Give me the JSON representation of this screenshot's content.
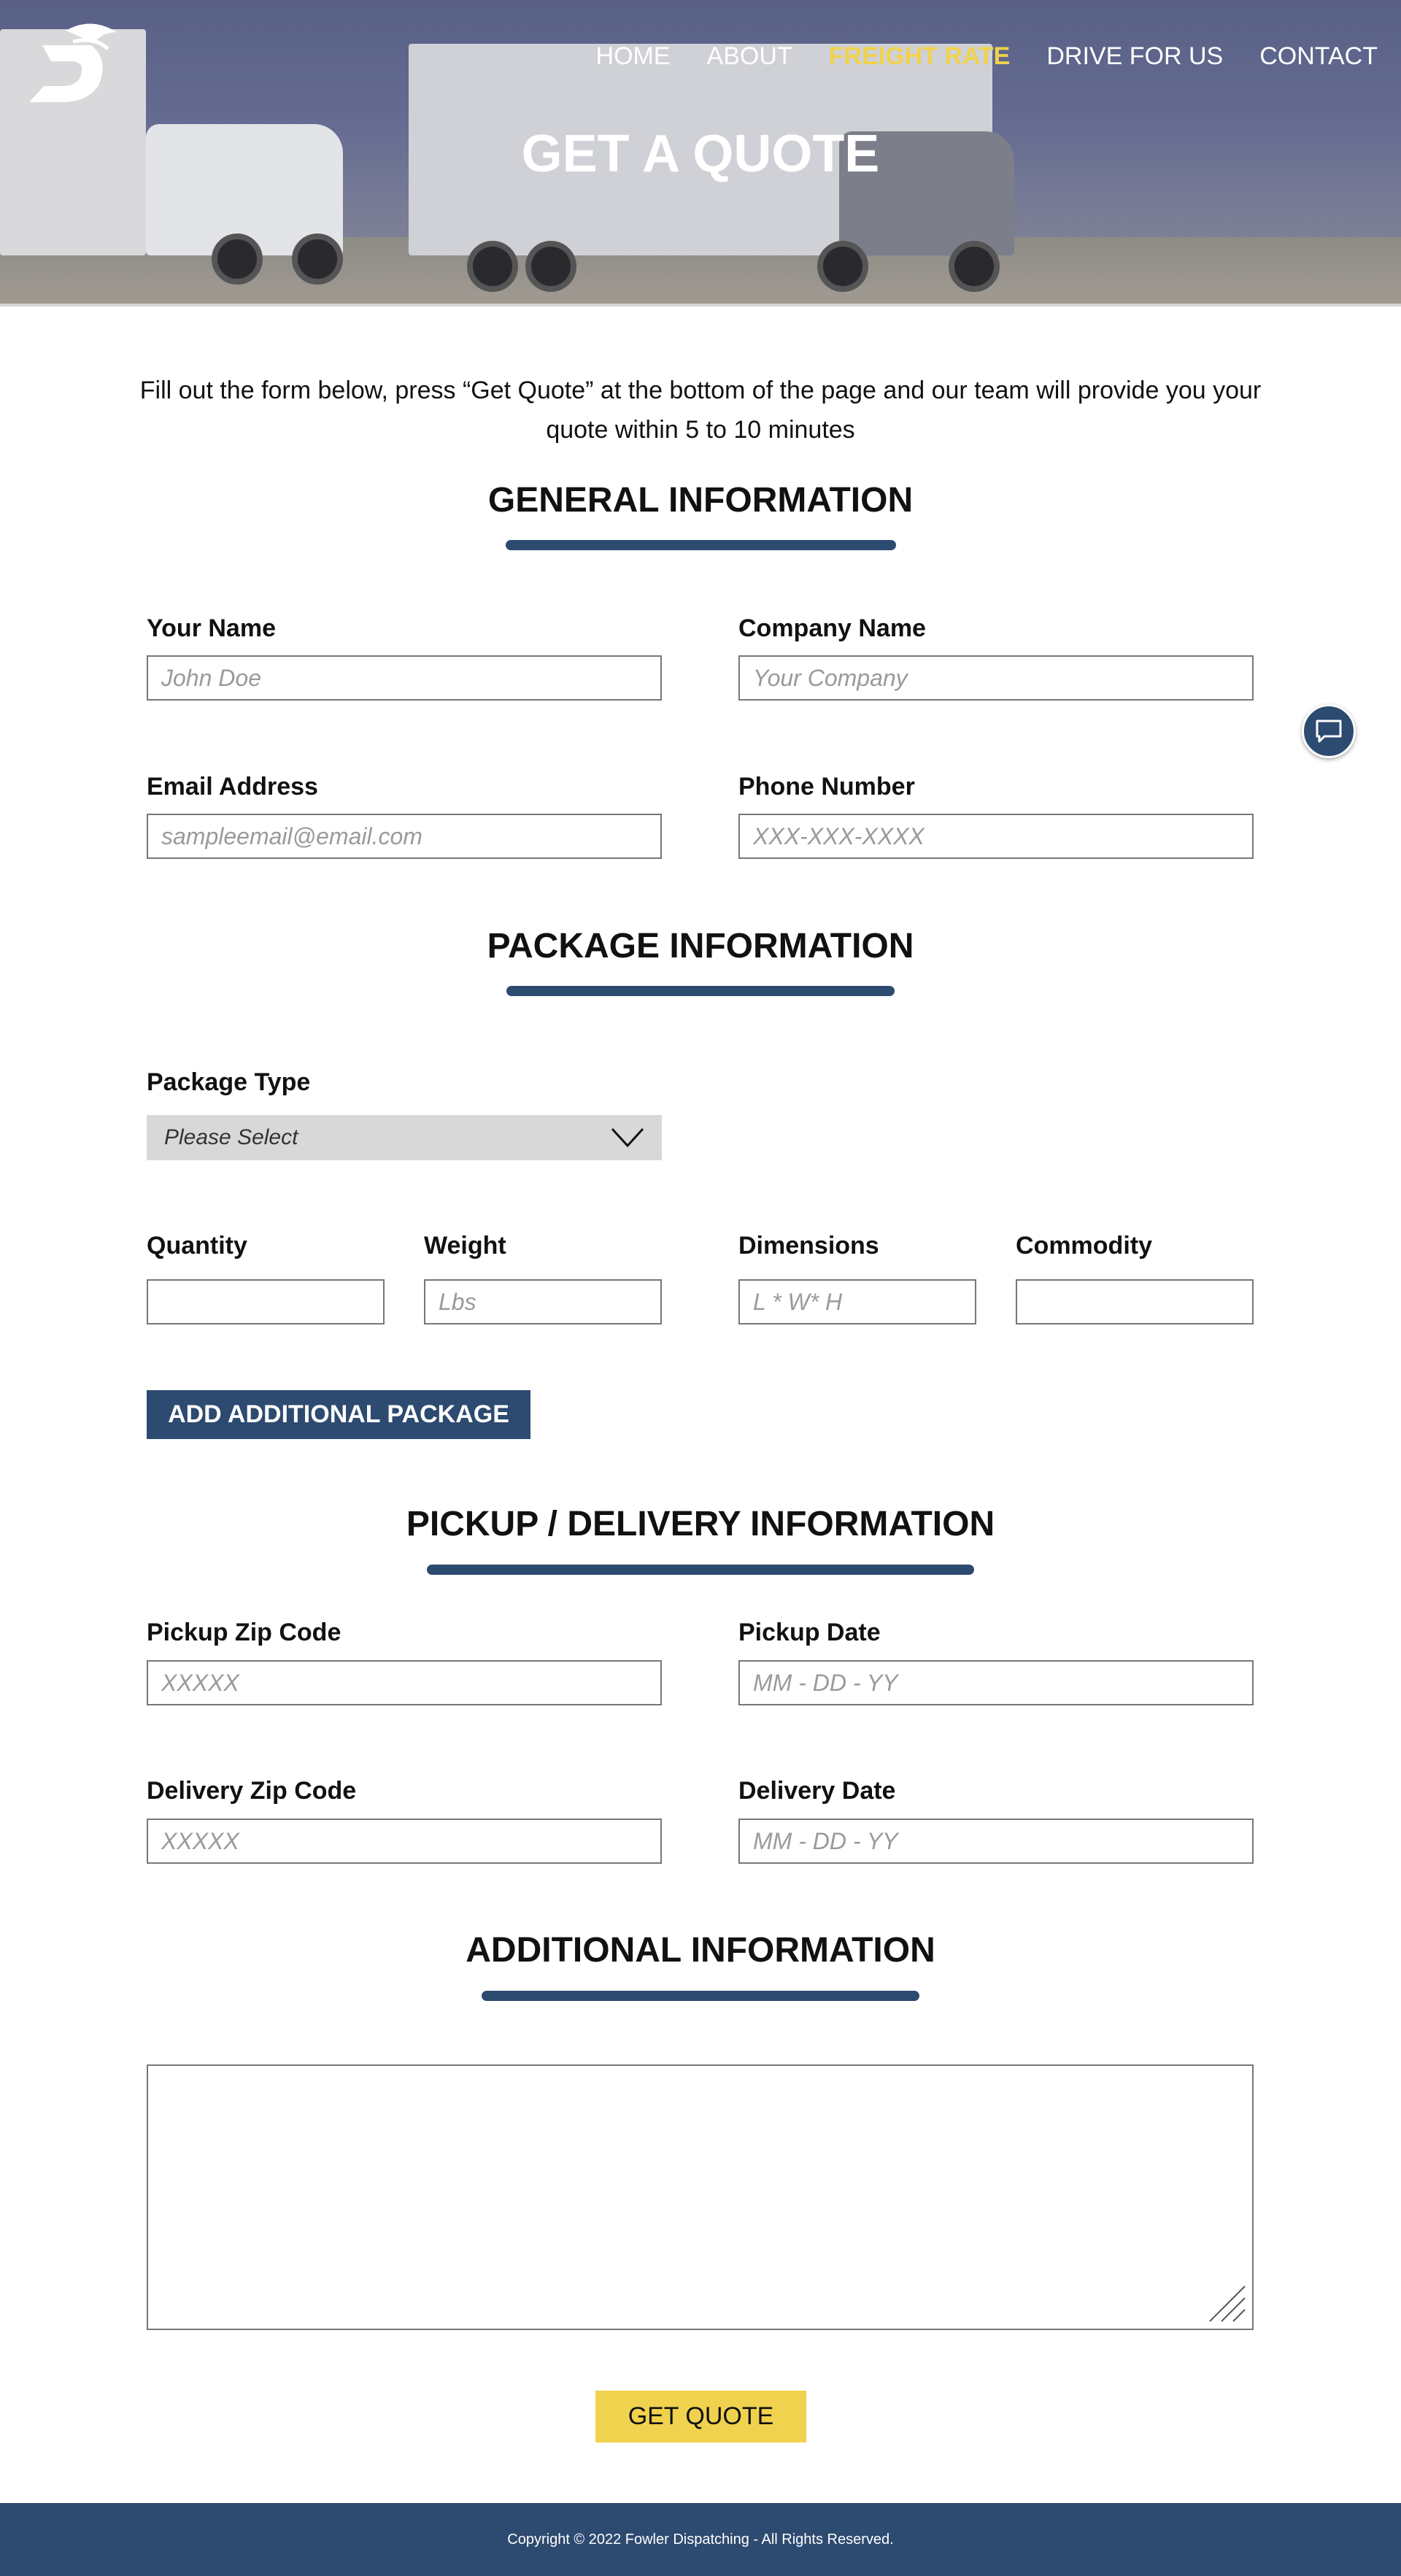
{
  "nav": {
    "items": [
      {
        "label": "HOME"
      },
      {
        "label": "ABOUT"
      },
      {
        "label": "FREIGHT RATE",
        "active": true
      },
      {
        "label": "DRIVE FOR US"
      },
      {
        "label": "CONTACT"
      }
    ]
  },
  "hero": {
    "title": "GET A QUOTE"
  },
  "intro": "Fill out the form below, press “Get Quote” at the bottom of the page and our team will provide you your quote within 5 to 10 minutes",
  "general": {
    "title": "GENERAL INFORMATION",
    "name_label": "Your Name",
    "name_placeholder": "John Doe",
    "company_label": "Company Name",
    "company_placeholder": "Your Company",
    "email_label": "Email Address",
    "email_placeholder": "sampleemail@email.com",
    "phone_label": "Phone Number",
    "phone_placeholder": "XXX-XXX-XXXX"
  },
  "package": {
    "title": "PACKAGE INFORMATION",
    "type_label": "Package Type",
    "type_value": "Please Select",
    "quantity_label": "Quantity",
    "quantity_placeholder": "",
    "weight_label": "Weight",
    "weight_placeholder": "Lbs",
    "dimensions_label": "Dimensions",
    "dimensions_placeholder": "L * W* H",
    "commodity_label": "Commodity",
    "commodity_placeholder": "",
    "add_button": "ADD ADDITIONAL PACKAGE"
  },
  "pickup": {
    "title": "PICKUP / DELIVERY INFORMATION",
    "pickup_zip_label": "Pickup Zip Code",
    "pickup_zip_placeholder": "XXXXX",
    "pickup_date_label": "Pickup Date",
    "pickup_date_placeholder": "MM - DD - YY",
    "delivery_zip_label": "Delivery Zip Code",
    "delivery_zip_placeholder": "XXXXX",
    "delivery_date_label": "Delivery Date",
    "delivery_date_placeholder": "MM - DD - YY"
  },
  "additional": {
    "title": "ADDITIONAL INFORMATION"
  },
  "submit_label": "GET QUOTE",
  "footer": "Copyright © 2022 Fowler Dispatching - All Rights Reserved.",
  "icons": {
    "chat": "chat-icon",
    "dropdown": "chevron-down-icon",
    "logo": "logo-icon",
    "resize": "resize-handle-icon"
  },
  "colors": {
    "accent": "#2d4a70",
    "highlight": "#f0d24e"
  }
}
